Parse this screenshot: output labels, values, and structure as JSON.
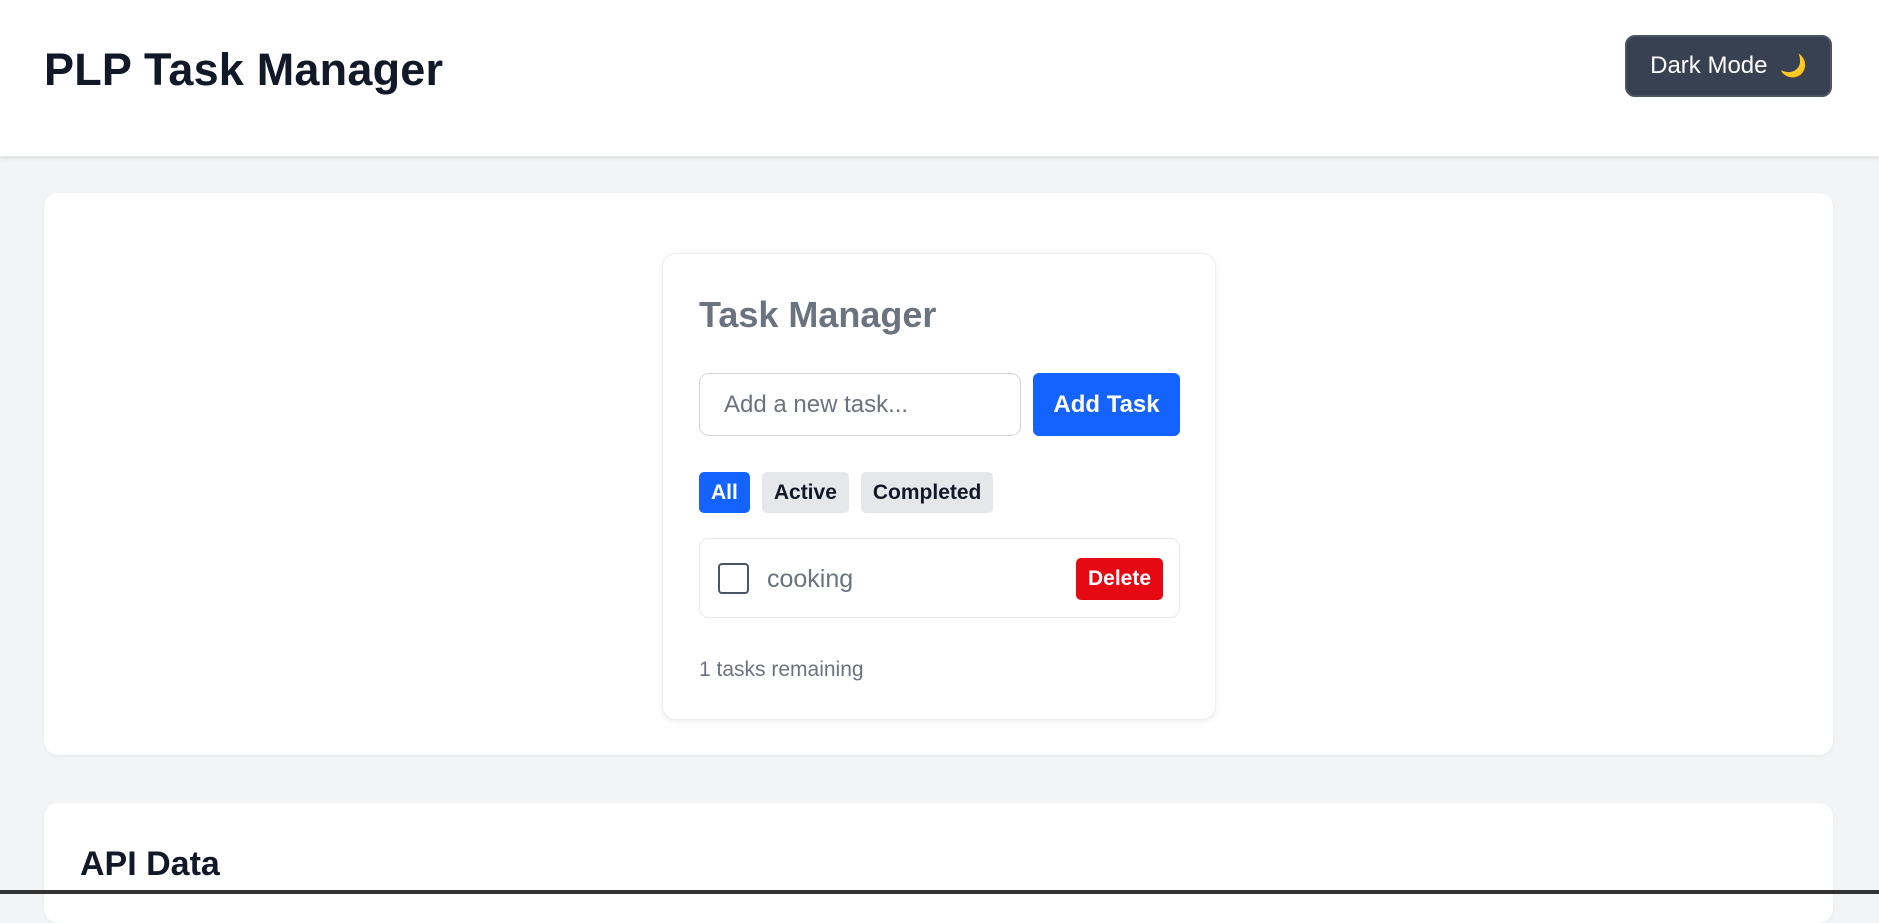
{
  "header": {
    "title": "PLP Task Manager",
    "dark_mode_label": "Dark Mode",
    "dark_mode_icon": "moon-icon"
  },
  "task_manager": {
    "title": "Task Manager",
    "input": {
      "value": "",
      "placeholder": "Add a new task..."
    },
    "add_button_label": "Add Task",
    "filters": [
      {
        "label": "All",
        "active": true
      },
      {
        "label": "Active",
        "active": false
      },
      {
        "label": "Completed",
        "active": false
      }
    ],
    "tasks": [
      {
        "text": "cooking",
        "completed": false,
        "delete_label": "Delete"
      }
    ],
    "remaining_text": "1 tasks remaining"
  },
  "api_section": {
    "title": "API Data"
  },
  "colors": {
    "primary": "#1463ff",
    "danger": "#e50914",
    "dark_button": "#374151",
    "background": "#f3f4f6"
  }
}
